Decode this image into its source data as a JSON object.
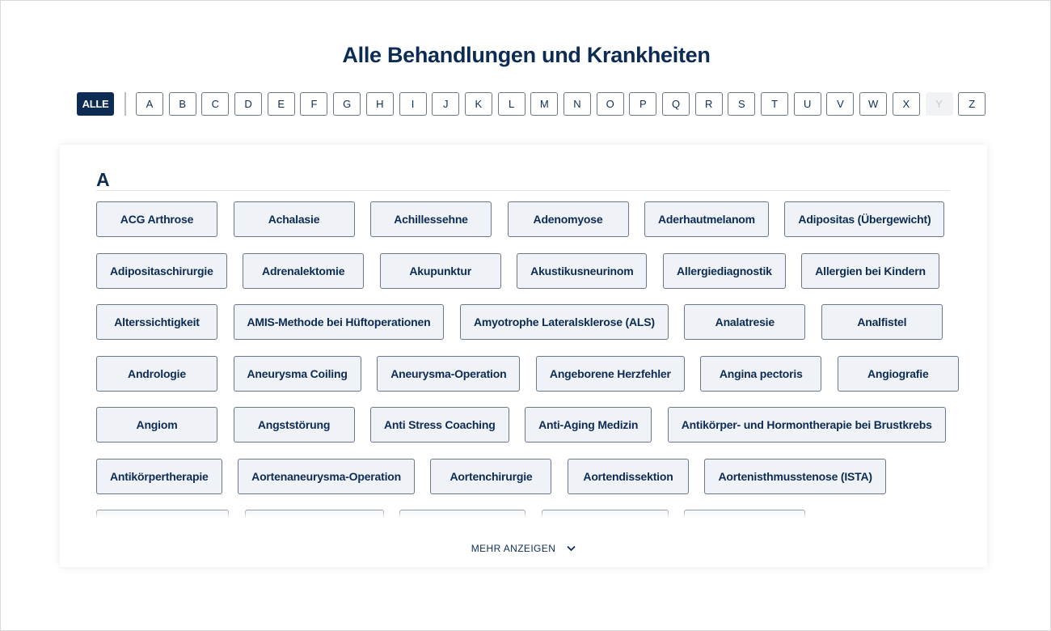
{
  "page": {
    "title": "Alle Behandlungen und Krankheiten"
  },
  "alphabet_filter": {
    "all_label": "ALLE",
    "all_active": true,
    "letters": [
      {
        "label": "A",
        "enabled": true
      },
      {
        "label": "B",
        "enabled": true
      },
      {
        "label": "C",
        "enabled": true
      },
      {
        "label": "D",
        "enabled": true
      },
      {
        "label": "E",
        "enabled": true
      },
      {
        "label": "F",
        "enabled": true
      },
      {
        "label": "G",
        "enabled": true
      },
      {
        "label": "H",
        "enabled": true
      },
      {
        "label": "I",
        "enabled": true
      },
      {
        "label": "J",
        "enabled": true
      },
      {
        "label": "K",
        "enabled": true
      },
      {
        "label": "L",
        "enabled": true
      },
      {
        "label": "M",
        "enabled": true
      },
      {
        "label": "N",
        "enabled": true
      },
      {
        "label": "O",
        "enabled": true
      },
      {
        "label": "P",
        "enabled": true
      },
      {
        "label": "Q",
        "enabled": true
      },
      {
        "label": "R",
        "enabled": true
      },
      {
        "label": "S",
        "enabled": true
      },
      {
        "label": "T",
        "enabled": true
      },
      {
        "label": "U",
        "enabled": true
      },
      {
        "label": "V",
        "enabled": true
      },
      {
        "label": "W",
        "enabled": true
      },
      {
        "label": "X",
        "enabled": true
      },
      {
        "label": "Y",
        "enabled": false
      },
      {
        "label": "Z",
        "enabled": true
      }
    ]
  },
  "section": {
    "letter": "A",
    "items": [
      "ACG Arthrose",
      "Achalasie",
      "Achillessehne",
      "Adenomyose",
      "Aderhautmelanom",
      "Adipositas (Übergewicht)",
      "Adipositaschirurgie",
      "Adrenalektomie",
      "Akupunktur",
      "Akustikusneurinom",
      "Allergiediagnostik",
      "Allergien bei Kindern",
      "Alterssichtigkeit",
      "AMIS-Methode bei Hüftoperationen",
      "Amyotrophe Lateralsklerose (ALS)",
      "Analatresie",
      "Analfistel",
      "Andrologie",
      "Aneurysma Coiling",
      "Aneurysma-Operation",
      "Angeborene Herzfehler",
      "Angina pectoris",
      "Angiografie",
      "Angiom",
      "Angststörung",
      "Anti Stress Coaching",
      "Anti-Aging Medizin",
      "Antikörper- und Hormontherapie bei Brustkrebs",
      "Antikörpertherapie",
      "Aortenaneurysma-Operation",
      "Aortenchirurgie",
      "Aortendissektion",
      "Aortenisthmusstenose (ISTA)"
    ],
    "cut_off_row_count": 5
  },
  "show_more": {
    "label": "MEHR ANZEIGEN",
    "icon": "chevron-down-icon"
  },
  "colors": {
    "brand_navy": "#0d2c54",
    "tag_bg": "#eff2f6",
    "tag_border": "#6b7686",
    "disabled_bg": "#f1f2f4"
  }
}
